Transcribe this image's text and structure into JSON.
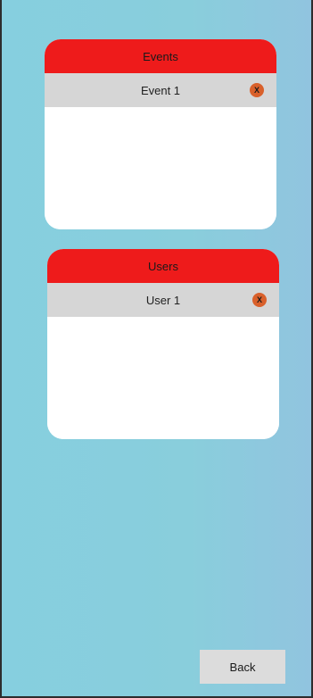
{
  "events": {
    "header": "Events",
    "items": [
      {
        "label": "Event 1",
        "remove_label": "X"
      }
    ]
  },
  "users": {
    "header": "Users",
    "items": [
      {
        "label": "User 1",
        "remove_label": "X"
      }
    ]
  },
  "footer": {
    "back_label": "Back"
  },
  "colors": {
    "header_red": "#ee1b1b",
    "row_gray": "#d6d6d6",
    "remove_orange": "#d9602b",
    "background": "#89cedc"
  }
}
